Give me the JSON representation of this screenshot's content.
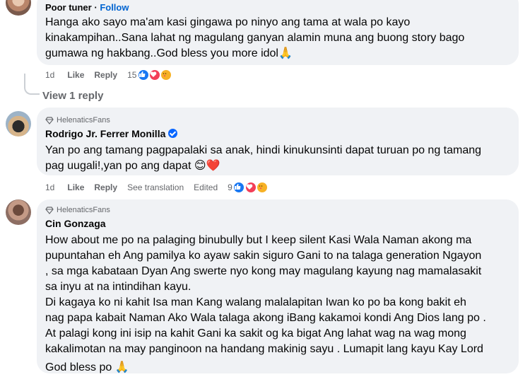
{
  "comments": [
    {
      "author": "Poor tuner",
      "follow_label": "Follow",
      "lines": [
        "Hanga ako sayo ma'am kasi gingawa po ninyo ang tama at wala po kayo",
        "kinakampihan..Sana lahat ng magulang ganyan alamin muna ang buong story bago",
        "gumawa ng hakbang..God bless you more idol🙏"
      ],
      "time": "1d",
      "like_label": "Like",
      "reply_label": "Reply",
      "reaction_count": "15",
      "reactions": [
        "like-icon",
        "love-icon",
        "care-icon"
      ],
      "view_replies": "View 1 reply"
    },
    {
      "badge": "HelenaticsFans",
      "author": "Rodrigo Jr. Ferrer Monilla",
      "lines": [
        "Yan po ang tamang pagpapalaki sa anak, hindi kinukunsinti dapat turuan po ng tamang",
        "pag uugali!,yan po ang dapat 😊❤️"
      ],
      "time": "1d",
      "like_label": "Like",
      "reply_label": "Reply",
      "see_translation": "See translation",
      "edited": "Edited",
      "reaction_count": "9",
      "reactions": [
        "like-icon",
        "love-icon",
        "care-icon"
      ]
    },
    {
      "badge": "HelenaticsFans",
      "author": "Cin Gonzaga",
      "lines": [
        "How about me po na palaging binubully but I keep silent Kasi Wala Naman akong ma",
        "pupuntahan eh Ang pamilya ko ayaw sakin siguro Gani to na talaga generation Ngayon",
        ", sa mga kabataan Dyan Ang swerte nyo kong may magulang kayung nag mamalasakit",
        "sa inyu at na intindihan kayu.",
        "Di kagaya ko ni kahit Isa man Kang walang malalapitan Iwan ko po ba kong bakit eh",
        "nag papa kabait Naman Ako Wala talaga akong iBang kakamoi kondi Ang Dios lang po .",
        "At palagi kong ini isip na kahit Gani ka sakit og ka bigat Ang lahat wag na wag mong",
        "kakalimotan na may panginoon na handang makinig sayu . Lumapit lang kayu Kay Lord",
        "God bless po 🙏"
      ]
    }
  ],
  "colors": {
    "bubble": "#f0f2f5",
    "meta": "#65676b",
    "link": "#0064d1",
    "like": "#1877f2",
    "love": "#f33e58",
    "care": "#f7b125",
    "verified": "#0866ff"
  }
}
